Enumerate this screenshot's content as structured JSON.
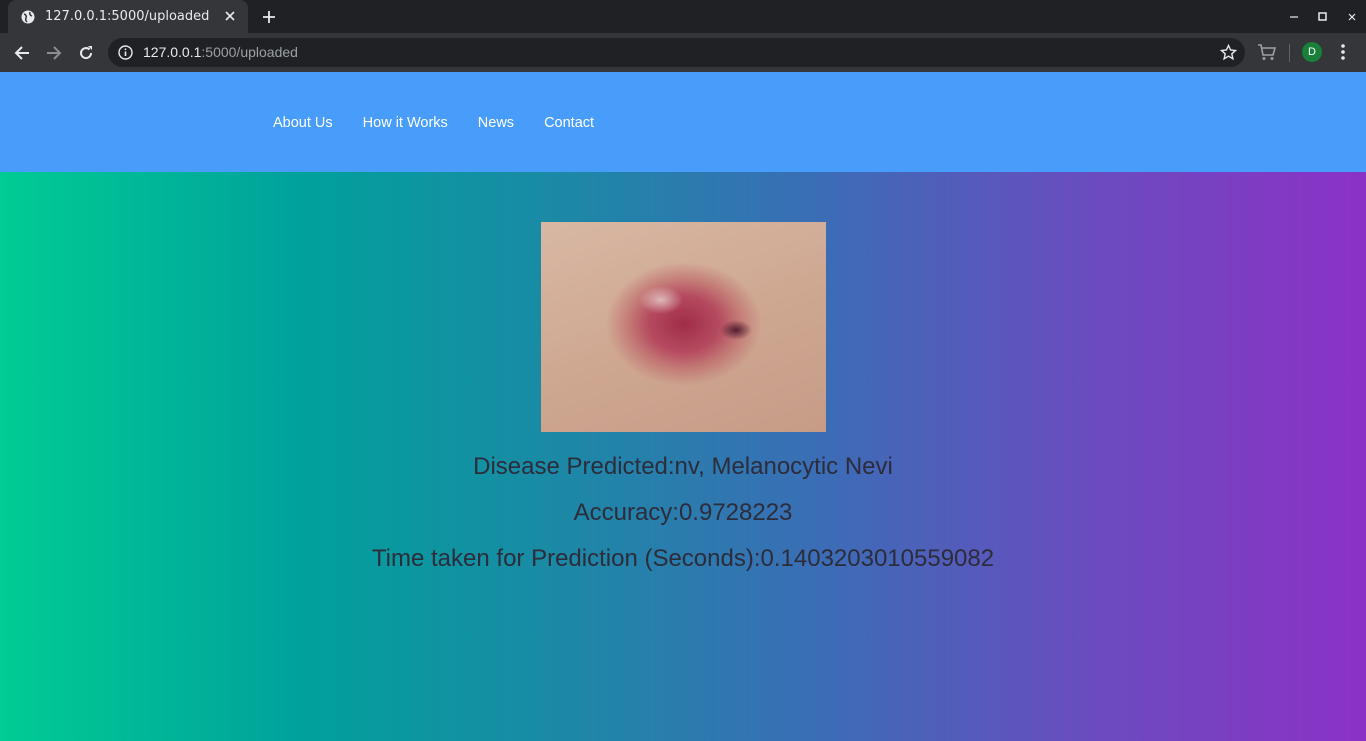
{
  "browser": {
    "tab_title": "127.0.0.1:5000/uploaded",
    "url_host": "127.0.0.1",
    "url_path": ":5000/uploaded",
    "profile_initial": "D"
  },
  "nav": {
    "links": [
      {
        "label": "About Us"
      },
      {
        "label": "How it Works"
      },
      {
        "label": "News"
      },
      {
        "label": "Contact"
      }
    ]
  },
  "result": {
    "disease": "Disease Predicted:nv, Melanocytic Nevi",
    "accuracy": "Accuracy:0.9728223",
    "time": "Time taken for Prediction (Seconds):0.1403203010559082"
  },
  "colors": {
    "nav_bg": "#479df9",
    "gradient_start": "#00cc94",
    "gradient_end": "#8c31c6"
  }
}
